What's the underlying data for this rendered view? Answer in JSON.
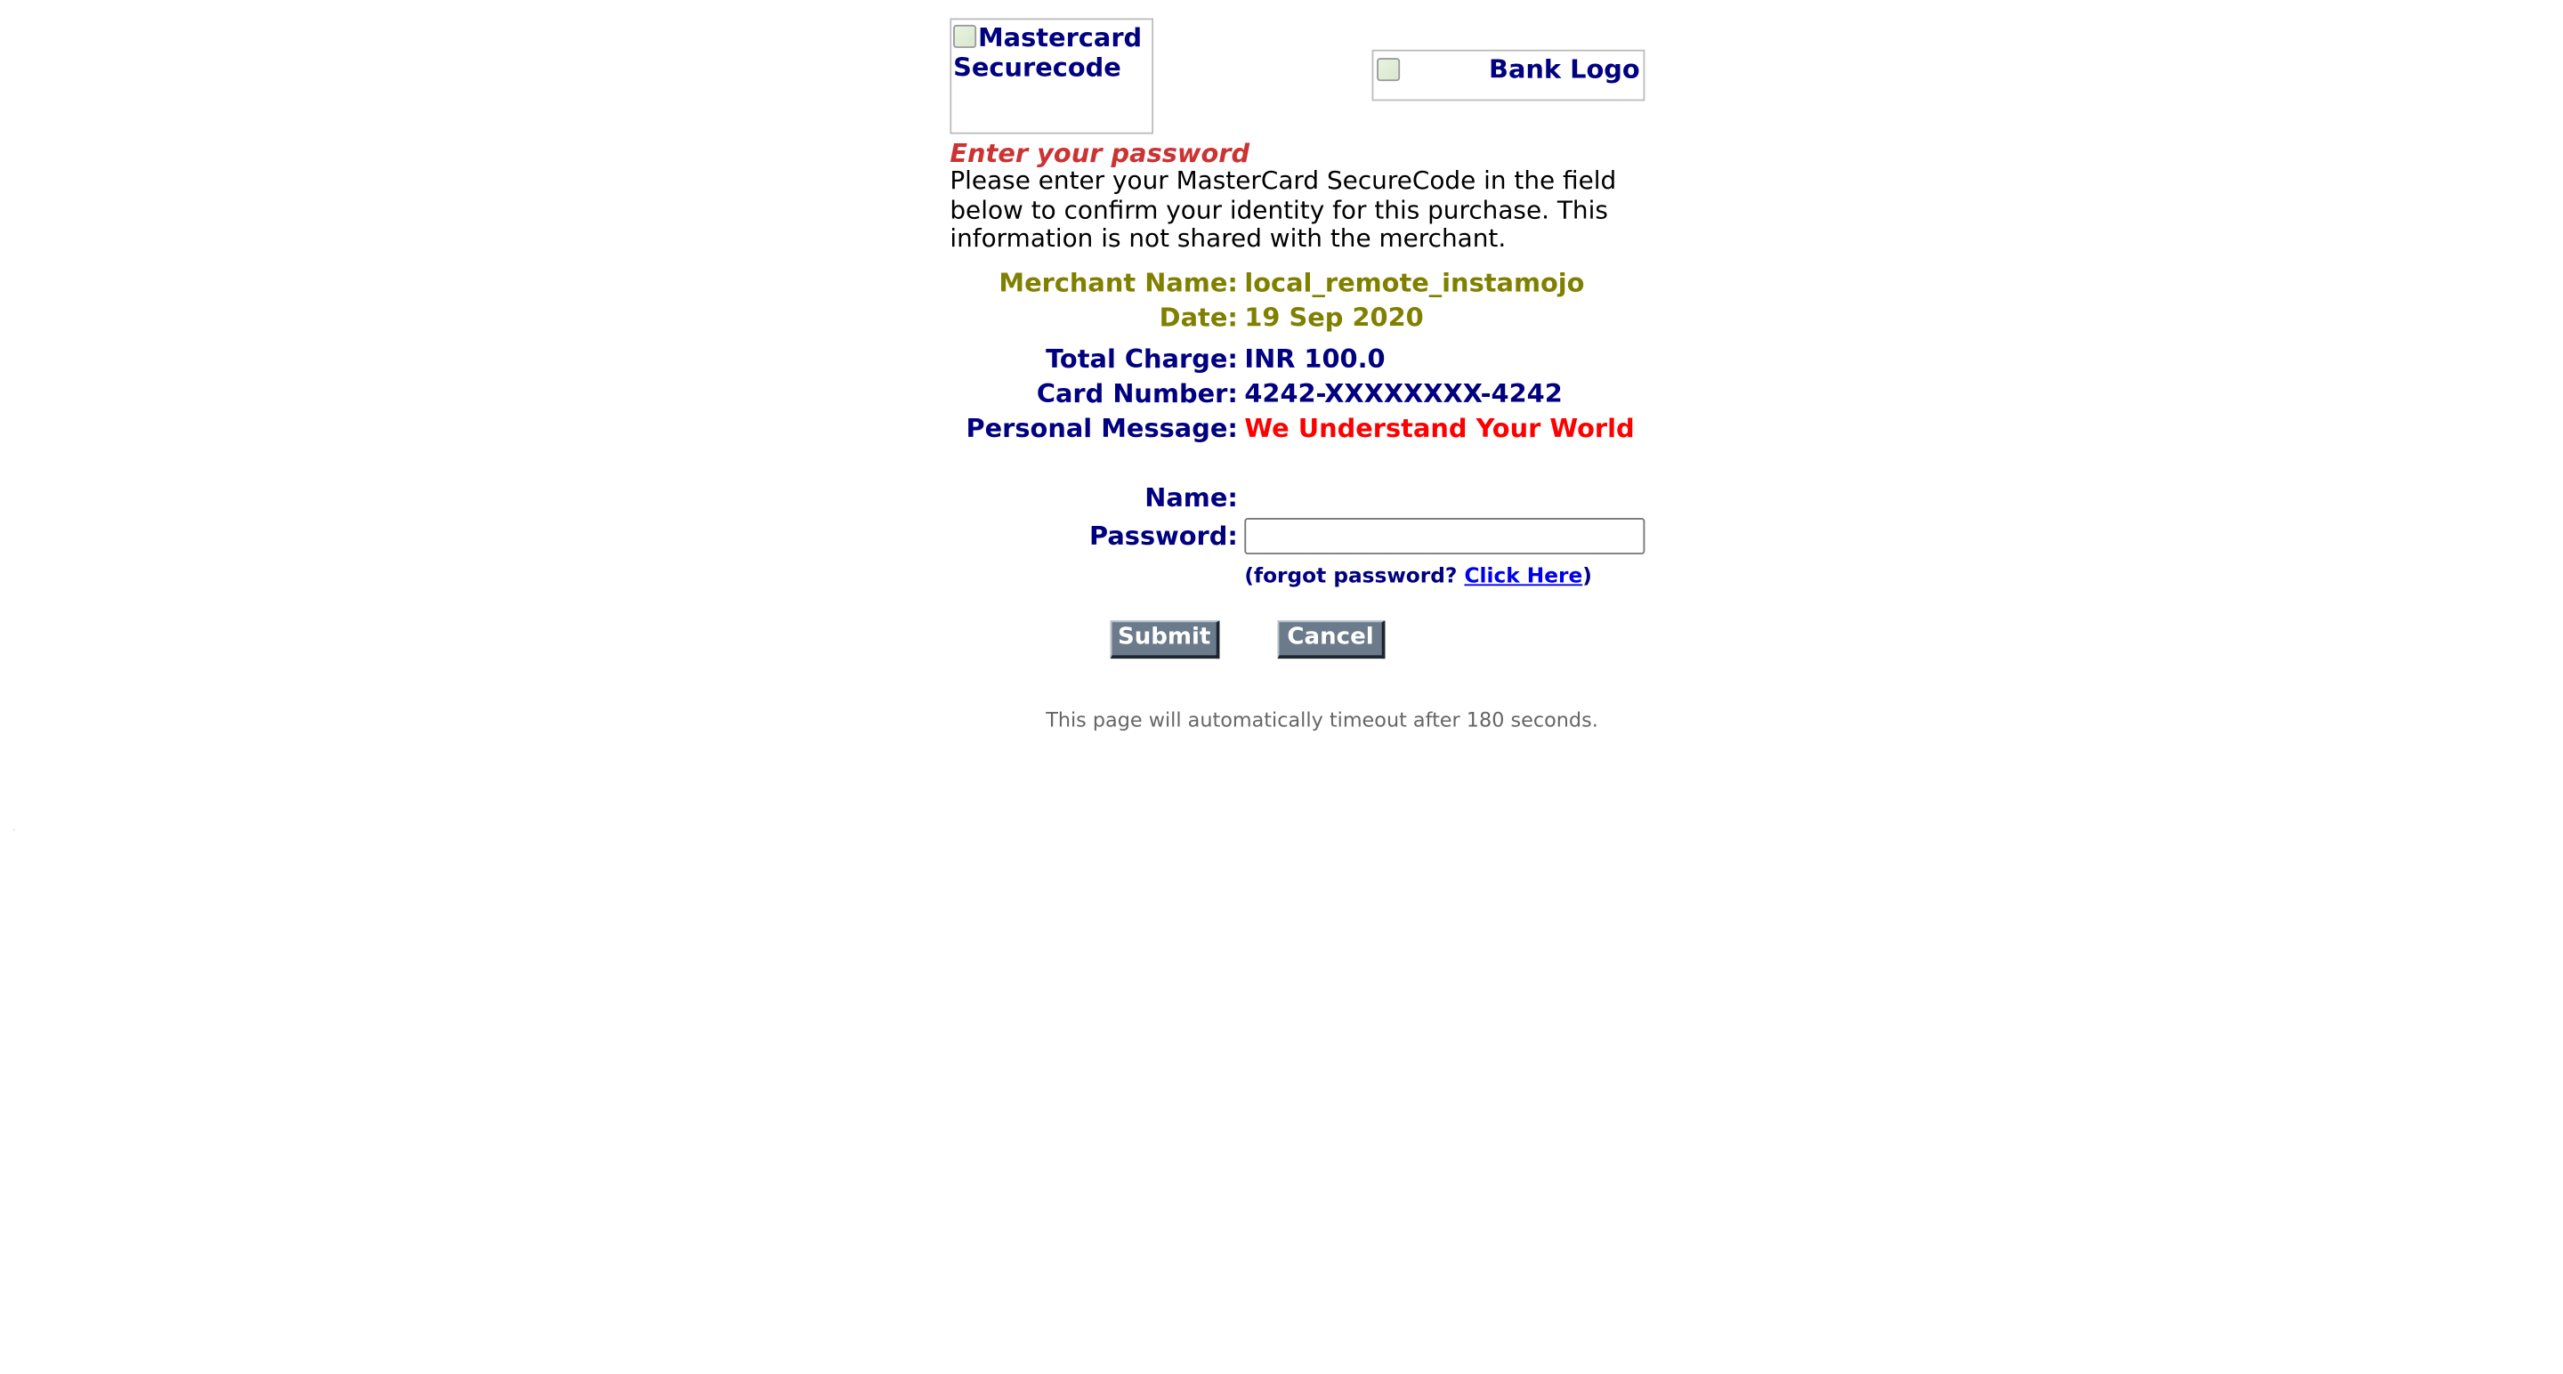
{
  "header": {
    "mastercard_logo_alt": "Mastercard Securecode",
    "bank_logo_alt": "Bank Logo"
  },
  "heading": "Enter your password",
  "instructions": "Please enter your MasterCard SecureCode in the field below to confirm your identity for this purchase. This information is not shared with the merchant.",
  "details": {
    "merchant_name_label": "Merchant Name:",
    "merchant_name_value": "local_remote_instamojo",
    "date_label": "Date:",
    "date_value": "19 Sep 2020",
    "total_charge_label": "Total Charge:",
    "total_charge_value": "INR 100.0",
    "card_number_label": "Card Number:",
    "card_number_value": "4242-XXXXXXXX-4242",
    "personal_message_label": "Personal Message:",
    "personal_message_value": "We Understand Your World"
  },
  "form": {
    "name_label": "Name:",
    "name_value": "",
    "password_label": "Password:",
    "password_value": "",
    "forgot_prefix": "(forgot password?",
    "forgot_link": "Click Here",
    "forgot_suffix": ")"
  },
  "buttons": {
    "submit_label": "Submit",
    "cancel_label": "Cancel"
  },
  "timeout_text": "This page will automatically timeout after 180 seconds.",
  "colors": {
    "heading": "#cc3333",
    "merchant_info": "#808000",
    "card_info": "#000080",
    "personal_message": "#ff0000",
    "link": "#0000ee",
    "button_bg": "#6b7b8c",
    "timeout_text": "#666666"
  },
  "icons": {
    "logo_placeholder": "broken-image-icon"
  }
}
